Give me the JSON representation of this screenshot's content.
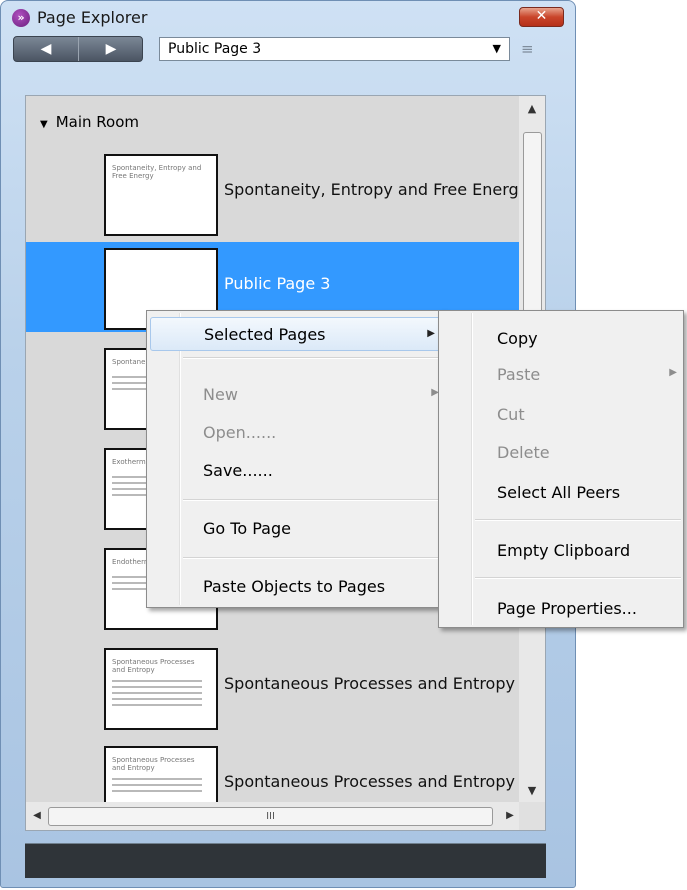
{
  "window": {
    "title": "Page Explorer",
    "close_label": "✕"
  },
  "toolbar": {
    "back_label": "◀",
    "forward_label": "▶",
    "page_select_value": "Public Page 3",
    "menu_icon": "≡"
  },
  "group": {
    "label": "Main Room"
  },
  "pages": [
    {
      "label": "Spontaneity, Entropy and Free Energy",
      "thumb_title": "Spontaneity, Entropy and Free Energy",
      "selected": false
    },
    {
      "label": "Public Page 3",
      "thumb_title": "",
      "selected": true
    },
    {
      "label": "",
      "thumb_title": "Spontane...",
      "selected": false
    },
    {
      "label": "",
      "thumb_title": "Exotherm...",
      "selected": false
    },
    {
      "label": "",
      "thumb_title": "Endotherm...",
      "selected": false
    },
    {
      "label": "Spontaneous Processes and Entropy",
      "thumb_title": "Spontaneous Processes and Entropy",
      "selected": false
    },
    {
      "label": "Spontaneous Processes and Entropy",
      "thumb_title": "Spontaneous Processes and Entropy",
      "selected": false
    }
  ],
  "hscroll": {
    "grip": "III"
  },
  "context_menu": {
    "items": [
      {
        "label": "Selected Pages",
        "disabled": false,
        "submenu": true
      },
      {
        "label": "New",
        "disabled": true,
        "submenu": true
      },
      {
        "label": "Open......",
        "disabled": true,
        "submenu": false
      },
      {
        "label": "Save......",
        "disabled": false,
        "submenu": false
      },
      {
        "label": "Go To Page",
        "disabled": false,
        "submenu": false
      },
      {
        "label": "Paste Objects to Pages",
        "disabled": false,
        "submenu": false
      }
    ]
  },
  "submenu": {
    "items": [
      {
        "label": "Copy",
        "disabled": false,
        "submenu": false
      },
      {
        "label": "Paste",
        "disabled": true,
        "submenu": true
      },
      {
        "label": "Cut",
        "disabled": true,
        "submenu": false
      },
      {
        "label": "Delete",
        "disabled": true,
        "submenu": false
      },
      {
        "label": "Select All Peers",
        "disabled": false,
        "submenu": false
      },
      {
        "label": "Empty Clipboard",
        "disabled": false,
        "submenu": false
      },
      {
        "label": "Page Properties...",
        "disabled": false,
        "submenu": false
      }
    ]
  },
  "colors": {
    "selection": "#3399ff",
    "close_button": "#c9452a"
  }
}
